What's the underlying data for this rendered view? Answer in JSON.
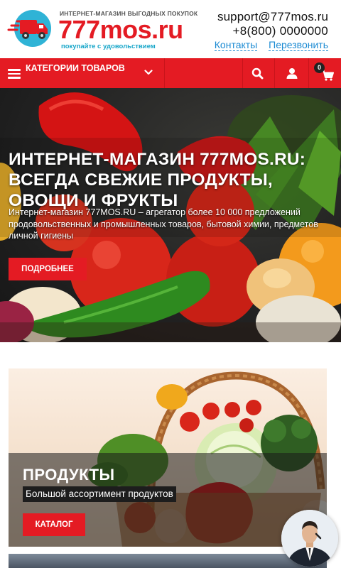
{
  "header": {
    "logo_tagline": "ИНТЕРНЕТ-МАГАЗИН ВЫГОДНЫХ ПОКУПОК",
    "logo_name": "777mos.ru",
    "logo_slogan": "покупайте с удовольствием",
    "email": "support@777mos.ru",
    "phone": "+8(800) 0000000",
    "link_contacts": "Контакты",
    "link_callback": "Перезвонить"
  },
  "nav": {
    "categories_label": "Категории товаров",
    "cart_count": "0"
  },
  "hero": {
    "title": "Интернет-магазин 777mos.ru: всегда свежие продукты, овощи и фрукты",
    "description": "Интернет-магазин 777MOS.RU – агрегатор более 10 000 предложений продовольственных и промышленных товаров, бытовой химии, предметов личной гигиены",
    "button": "Подробнее"
  },
  "category_card": {
    "title": "Продукты",
    "subtitle": "Большой ассортимент продуктов",
    "button": "Каталог"
  },
  "colors": {
    "brand_red": "#e41b23",
    "link_blue": "#1d8bd3",
    "slogan_blue": "#17a6c9"
  },
  "icons": [
    "truck-logo-icon",
    "menu-icon",
    "chevron-down-icon",
    "search-icon",
    "user-icon",
    "cart-icon"
  ]
}
